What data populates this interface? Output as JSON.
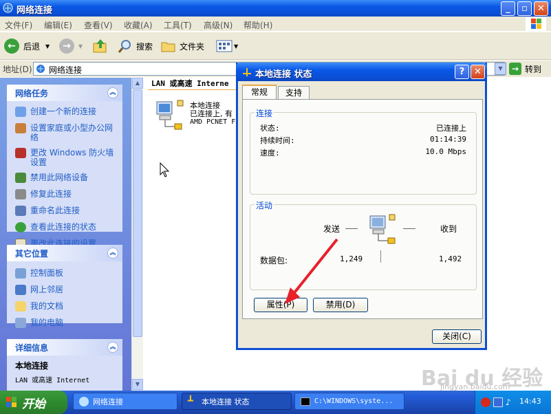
{
  "window": {
    "title": "网络连接",
    "minimize": "_",
    "maximize": "▫",
    "close": "✕"
  },
  "menu": [
    "文件(F)",
    "编辑(E)",
    "查看(V)",
    "收藏(A)",
    "工具(T)",
    "高级(N)",
    "帮助(H)"
  ],
  "toolbar": {
    "back": "后退",
    "search": "搜索",
    "folders": "文件夹"
  },
  "address": {
    "label": "地址(D)",
    "value": "网络连接",
    "go": "转到"
  },
  "tasks": {
    "title": "网络任务",
    "items": [
      "创建一个新的连接",
      "设置家庭或小型办公网络",
      "更改 Windows 防火墙设置",
      "禁用此网络设备",
      "修复此连接",
      "重命名此连接",
      "查看此连接的状态",
      "更改此连接的设置"
    ]
  },
  "places": {
    "title": "其它位置",
    "items": [
      "控制面板",
      "网上邻居",
      "我的文档",
      "我的电脑"
    ]
  },
  "details": {
    "title": "详细信息",
    "name": "本地连接",
    "line": "LAN 或高速 Internet"
  },
  "main": {
    "column_header": "LAN 或高速 Interne",
    "item_name": "本地连接",
    "item_status": "已连接上, 有",
    "item_device": "AMD PCNET F"
  },
  "dialog": {
    "title": "本地连接 状态",
    "tabs": [
      "常规",
      "支持"
    ],
    "connection_group": "连接",
    "status_label": "状态:",
    "status_value": "已连接上",
    "duration_label": "持续时间:",
    "duration_value": "01:14:39",
    "speed_label": "速度:",
    "speed_value": "10.0 Mbps",
    "activity_group": "活动",
    "sent_label": "发送",
    "received_label": "收到",
    "packets_label": "数据包:",
    "packets_sent": "1,249",
    "packets_received": "1,492",
    "properties_button": "属性(P)",
    "disable_button": "禁用(D)",
    "close_button": "关闭(C)",
    "help_button": "?",
    "close_x": "✕"
  },
  "taskbar": {
    "start": "开始",
    "items": [
      "网络连接",
      "本地连接 状态",
      "C:\\WINDOWS\\syste..."
    ],
    "clock": "14:43"
  },
  "watermark": {
    "text": "Bai du 经验",
    "url": "jingyan.baidu.com"
  }
}
